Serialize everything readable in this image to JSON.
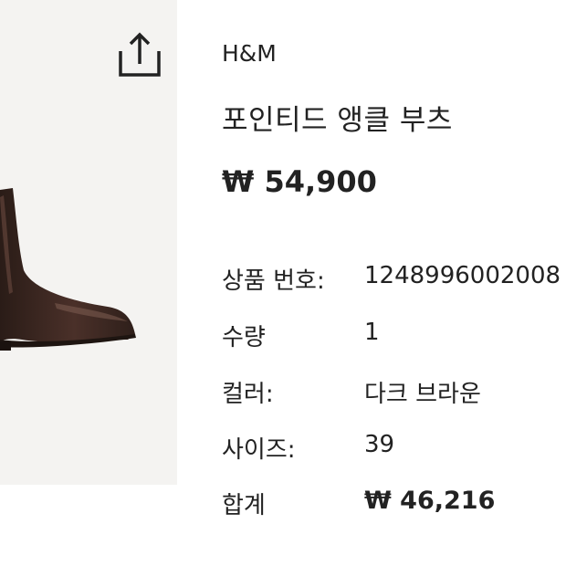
{
  "product": {
    "brand": "H&M",
    "name": "포인티드 앵클 부츠",
    "price": "₩ 54,900"
  },
  "share": {
    "icon": "share-icon"
  },
  "details": [
    {
      "label": "상품 번호:",
      "value": "1248996002008"
    },
    {
      "label": "수량",
      "value": "1"
    },
    {
      "label": "컬러:",
      "value": "다크 브라운"
    },
    {
      "label": "사이즈:",
      "value": "39"
    },
    {
      "label": "합계",
      "value": "₩ 46,216"
    }
  ],
  "colors": {
    "text": "#222222",
    "image_background": "#f4f3f1",
    "boot": "#3a2a24"
  }
}
